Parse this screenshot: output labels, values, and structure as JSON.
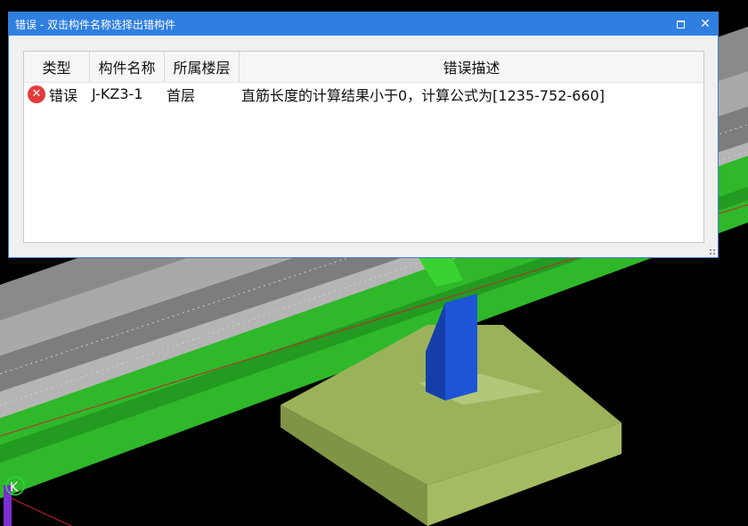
{
  "dialog": {
    "title": "错误 - 双击构件名称选择出错构件"
  },
  "table": {
    "headers": [
      "类型",
      "构件名称",
      "所属楼层",
      "错误描述"
    ],
    "rows": [
      {
        "icon": "error-icon",
        "type": "错误",
        "name": "J-KZ3-1",
        "floor": "首层",
        "description": "直筋长度的计算结果小于0，计算公式为[1235-752-660]"
      }
    ]
  },
  "viewport": {
    "axis_label": "K"
  },
  "colors": {
    "titlebar": "#2f7fe0",
    "error": "#e23b3b",
    "beam_green": "#2fb82a",
    "footing": "#9bb25a",
    "column_blue": "#1e55d6"
  }
}
